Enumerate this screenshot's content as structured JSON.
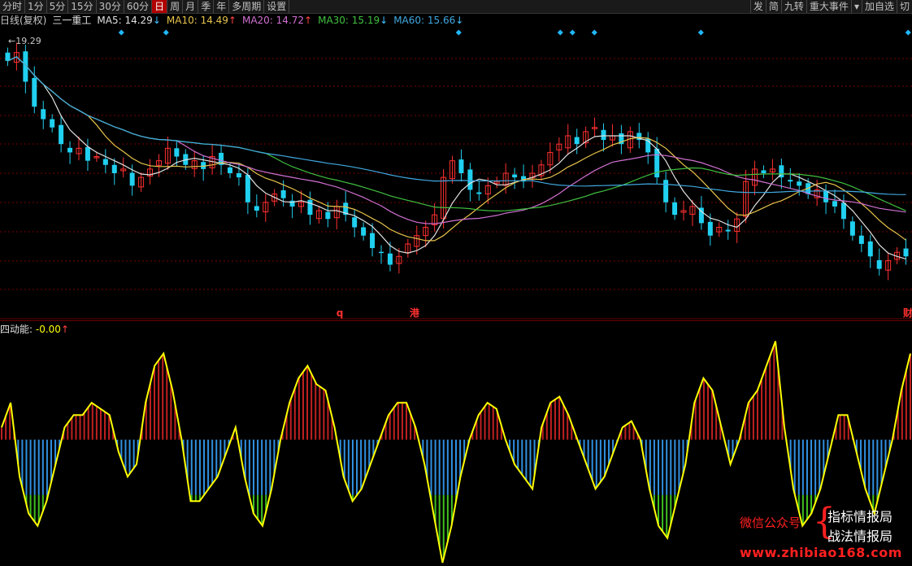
{
  "toolbar": {
    "tabs": [
      "分时",
      "1分",
      "5分",
      "15分",
      "30分",
      "60分",
      "日",
      "周",
      "月",
      "季",
      "年",
      "多周期",
      "设置"
    ],
    "active_tab": "日",
    "right_buttons": [
      "发",
      "简",
      "九转",
      "重大事件",
      "▾",
      "加自选",
      "切"
    ]
  },
  "infobar": {
    "mode": "日线(复权)",
    "stock_name": "三一重工",
    "ma": [
      {
        "label": "MA5: 14.29",
        "arrow": "↓",
        "color": "#e0e0e0"
      },
      {
        "label": "MA10: 14.49",
        "arrow": "↑",
        "color": "#e6c34a"
      },
      {
        "label": "MA20: 14.72",
        "arrow": "↑",
        "color": "#d070d0"
      },
      {
        "label": "MA30: 15.19",
        "arrow": "↓",
        "color": "#40c040"
      },
      {
        "label": "MA60: 15.66",
        "arrow": "↓",
        "color": "#40a8e0"
      }
    ]
  },
  "price_labels": {
    "high": "19.29",
    "markers": [
      {
        "text": "q",
        "color": "#ff3030"
      },
      {
        "text": "港",
        "color": "#ff3030"
      },
      {
        "text": "财",
        "color": "#ff3030"
      }
    ]
  },
  "oscillator": {
    "name": "四动能:",
    "value": "-0.00",
    "arrow": "↑"
  },
  "watermark": {
    "wechat": "微信公众号",
    "brace": "{",
    "line1": "指标情报局",
    "line2": "战法情报局",
    "url": "www.zhibiao168.com"
  },
  "colors": {
    "up": "#ff3030",
    "down": "#20d0f0",
    "bar_pos": "#c02020",
    "bar_neg": "#3090e0",
    "bar_low": "#40c020",
    "osc_line": "#ffff00",
    "grid": "#7a0000"
  },
  "chart_data": {
    "type": "candlestick",
    "title": "",
    "xlabel": "",
    "ylabel": "",
    "high_label_value": 19.29,
    "ylim": [
      12.8,
      19.8
    ],
    "closes": [
      19.0,
      19.2,
      18.5,
      17.9,
      17.6,
      17.4,
      17.0,
      16.8,
      16.9,
      16.6,
      16.7,
      16.5,
      16.3,
      16.4,
      16.0,
      16.2,
      16.4,
      16.6,
      16.9,
      16.7,
      16.5,
      16.6,
      16.4,
      16.7,
      16.5,
      16.3,
      16.2,
      15.6,
      15.4,
      15.6,
      15.8,
      15.7,
      15.5,
      15.6,
      15.3,
      15.4,
      15.2,
      15.5,
      15.3,
      15.0,
      14.8,
      14.5,
      14.4,
      14.1,
      14.3,
      14.6,
      14.8,
      15.0,
      15.3,
      16.2,
      16.6,
      16.3,
      15.9,
      15.8,
      16.0,
      16.1,
      16.3,
      16.2,
      16.1,
      16.3,
      16.5,
      16.8,
      17.0,
      17.2,
      17.0,
      17.3,
      17.4,
      17.1,
      17.2,
      17.0,
      17.3,
      17.1,
      16.8,
      16.2,
      15.6,
      15.3,
      15.4,
      15.5,
      15.1,
      14.8,
      15.0,
      14.9,
      15.2,
      16.1,
      16.4,
      16.3,
      16.4,
      16.2,
      16.1,
      16.0,
      15.8,
      15.9,
      15.6,
      15.5,
      15.2,
      14.8,
      14.6,
      14.3,
      14.0,
      14.2,
      14.4,
      14.3
    ],
    "oscillator": {
      "name": "四动能",
      "ylim": [
        -1.0,
        0.85
      ],
      "values": [
        0.1,
        0.3,
        -0.3,
        -0.6,
        -0.7,
        -0.5,
        -0.2,
        0.1,
        0.2,
        0.2,
        0.3,
        0.25,
        0.2,
        -0.1,
        -0.3,
        -0.2,
        0.3,
        0.6,
        0.7,
        0.4,
        0.0,
        -0.5,
        -0.5,
        -0.4,
        -0.3,
        -0.1,
        0.1,
        -0.3,
        -0.6,
        -0.7,
        -0.4,
        0.0,
        0.3,
        0.5,
        0.6,
        0.45,
        0.4,
        0.1,
        -0.3,
        -0.5,
        -0.4,
        -0.2,
        0.0,
        0.2,
        0.3,
        0.3,
        0.1,
        -0.2,
        -0.6,
        -1.0,
        -0.7,
        -0.3,
        0.0,
        0.2,
        0.3,
        0.25,
        0.0,
        -0.2,
        -0.3,
        -0.4,
        0.1,
        0.3,
        0.35,
        0.2,
        0.0,
        -0.2,
        -0.4,
        -0.3,
        -0.1,
        0.1,
        0.15,
        0.0,
        -0.4,
        -0.7,
        -0.8,
        -0.5,
        -0.2,
        0.3,
        0.5,
        0.4,
        0.1,
        -0.2,
        0.0,
        0.3,
        0.4,
        0.6,
        0.8,
        0.1,
        -0.4,
        -0.7,
        -0.6,
        -0.4,
        -0.1,
        0.2,
        0.2,
        -0.1,
        -0.4,
        -0.6,
        -0.3,
        0.0,
        0.4,
        0.7
      ]
    }
  }
}
